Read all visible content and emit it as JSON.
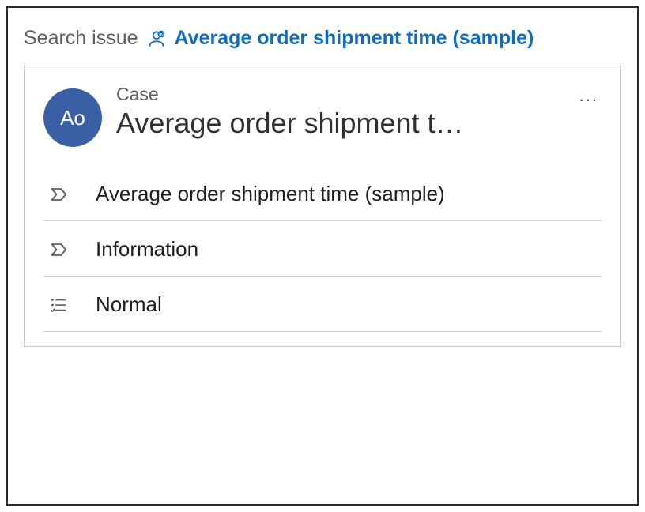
{
  "breadcrumb": {
    "root": "Search issue",
    "current": "Average order shipment time (sample)"
  },
  "card": {
    "avatar_initials": "Ao",
    "entity_label": "Case",
    "title": "Average order shipment t…",
    "rows": [
      {
        "text": "Average order shipment time (sample)"
      },
      {
        "text": "Information"
      },
      {
        "text": "Normal"
      }
    ]
  }
}
